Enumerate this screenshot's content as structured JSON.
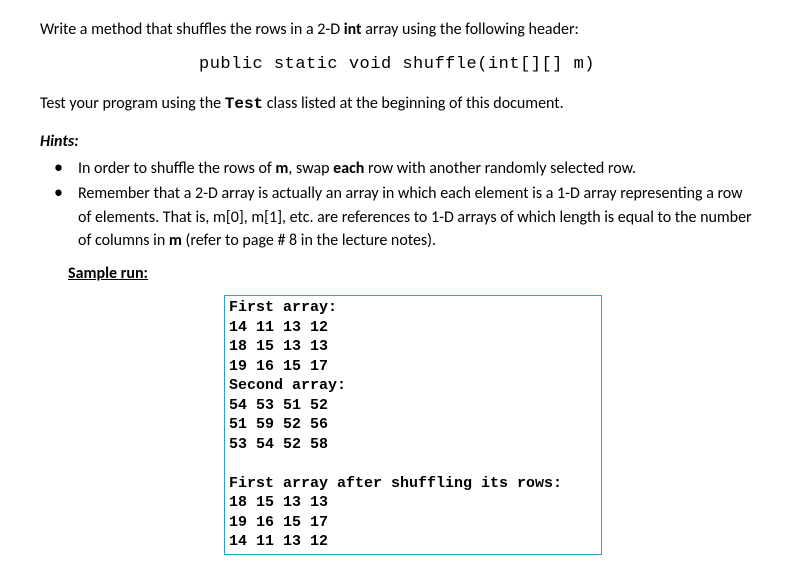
{
  "intro": {
    "pre": "Write a method that shuffles the rows in a 2-D ",
    "bold1": "int",
    "post": " array using the following header:"
  },
  "code_header": "public static void shuffle(int[][] m)",
  "test_line": {
    "pre": "Test your program using the ",
    "bold1": "Test",
    "post": " class listed at the beginning of this document."
  },
  "hints_label": "Hints:",
  "hints": [
    {
      "parts": [
        {
          "t": "In order to shuffle the rows of "
        },
        {
          "t": "m",
          "b": true
        },
        {
          "t": ", swap "
        },
        {
          "t": "each",
          "b": true
        },
        {
          "t": " row with another randomly selected row."
        }
      ]
    },
    {
      "parts": [
        {
          "t": "Remember that a 2-D array is actually an array in which each element is a 1-D array representing a row of elements. That is, m[0], m[1], etc. are references to 1-D arrays of which length is equal to the number of columns in "
        },
        {
          "t": "m",
          "b": true
        },
        {
          "t": " (refer to page # 8 in the lecture notes)."
        }
      ]
    }
  ],
  "sample_run_label": "Sample run:",
  "output": "First array:\n14 11 13 12\n18 15 13 13\n19 16 15 17\nSecond array:\n54 53 51 52\n51 59 52 56\n53 54 52 58\n\nFirst array after shuffling its rows:\n18 15 13 13\n19 16 15 17\n14 11 13 12"
}
